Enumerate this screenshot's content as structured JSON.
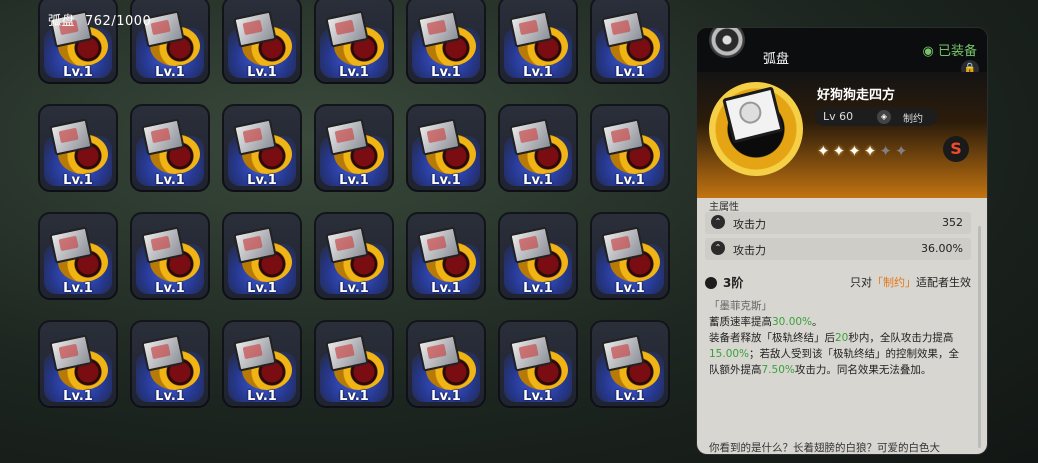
{
  "header": {
    "category": "弧盘",
    "count": "762/1000"
  },
  "grid": {
    "level_label": "Lv.1",
    "rows": 4,
    "cols": 7
  },
  "detail": {
    "category": "弧盘",
    "equipped_label": "已装备",
    "name": "好狗狗走四方",
    "level": "Lv 60",
    "mode_label": "制约",
    "stars_total": 6,
    "stars_filled": 4,
    "rank_label": "S",
    "section_main": "主属性",
    "stats": [
      {
        "name": "攻击力",
        "value": "352"
      },
      {
        "name": "攻击力",
        "value": "36.00%"
      }
    ],
    "tier": "3阶",
    "tier_note_prefix": "只对",
    "tier_note_hl": "「制约」",
    "tier_note_suffix": "适配者生效",
    "effect_title": "「墨菲克斯」",
    "effect_line1_a": "蓄质速率提高",
    "effect_line1_b": "30.00%",
    "effect_line1_c": "。",
    "effect_line2_a": "装备者释放「极轨终结」后",
    "effect_line2_b": "20",
    "effect_line2_c": "秒内，全队攻击力提高",
    "effect_line2_d": "15.00%",
    "effect_line2_e": "；若敌人受到该「极轨终结」的控制效果，全队额外提高",
    "effect_line2_f": "7.50%",
    "effect_line2_g": "攻击力。同名效果无法叠加。",
    "flavor": "你看到的是什么？长着翅膀的白狼？可爱的白色大"
  },
  "colors": {
    "accent_orange": "#e3781a",
    "equipped_green": "#76c36a",
    "highlight_green": "#3aa13a"
  }
}
